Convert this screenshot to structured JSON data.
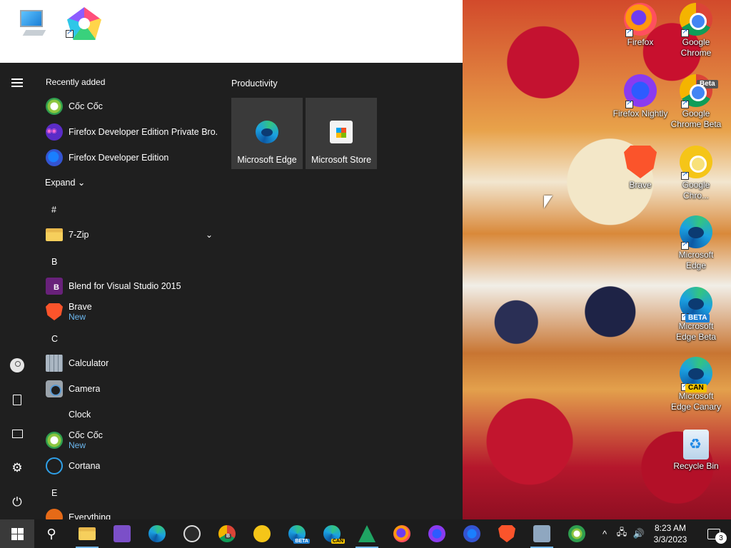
{
  "desktop": {
    "top_icons": [
      {
        "name": "this-pc",
        "icon": "computer-icon"
      },
      {
        "name": "coc-coc-shortcut",
        "icon": "coccoc-icon"
      }
    ],
    "right_icons": [
      {
        "label": "Firefox",
        "icon": "firefox-icon"
      },
      {
        "label": "Google Chrome",
        "icon": "chrome-icon"
      },
      {
        "label": "Firefox Nightly",
        "icon": "firefox-nightly-icon"
      },
      {
        "label": "Google Chrome Beta",
        "icon": "chrome-beta-icon",
        "badge": "Beta"
      },
      {
        "label": "Brave",
        "icon": "brave-icon"
      },
      {
        "label": "Google Chro...",
        "icon": "chrome-canary-icon"
      },
      {
        "label": "Microsoft Edge",
        "icon": "edge-icon"
      },
      {
        "label": "Microsoft Edge Beta",
        "icon": "edge-beta-icon",
        "badge": "BETA"
      },
      {
        "label": "Microsoft Edge Canary",
        "icon": "edge-canary-icon",
        "badge": "CAN"
      },
      {
        "label": "Recycle Bin",
        "icon": "recycle-bin-icon"
      }
    ]
  },
  "start_menu": {
    "recently_added_title": "Recently added",
    "recently_added": [
      {
        "name": "Cốc Cốc",
        "icon": "coccoc-icon"
      },
      {
        "name": "Firefox Developer Edition Private Bro...",
        "icon": "firefox-dev-private-icon"
      },
      {
        "name": "Firefox Developer Edition",
        "icon": "firefox-dev-icon"
      }
    ],
    "expand_label": "Expand",
    "letters": {
      "hash": "#",
      "b": "B",
      "c": "C",
      "e": "E"
    },
    "apps": [
      {
        "name": "7-Zip",
        "icon": "folder-icon"
      },
      {
        "name": "Blend for Visual Studio 2015",
        "icon": "blend-icon"
      },
      {
        "name": "Brave",
        "sub": "New",
        "icon": "brave-icon"
      },
      {
        "name": "Calculator",
        "icon": "calculator-icon"
      },
      {
        "name": "Camera",
        "icon": "camera-icon"
      },
      {
        "name": "Clock",
        "icon": "clock-icon"
      },
      {
        "name": "Cốc Cốc",
        "sub": "New",
        "icon": "coccoc-icon"
      },
      {
        "name": "Cortana",
        "icon": "cortana-icon"
      },
      {
        "name": "Everything",
        "icon": "everything-icon"
      }
    ],
    "tiles_title": "Productivity",
    "tiles": [
      {
        "label": "Microsoft Edge",
        "icon": "edge-icon"
      },
      {
        "label": "Microsoft Store",
        "icon": "store-icon"
      }
    ]
  },
  "taskbar": {
    "clock_time": "8:23 AM",
    "clock_date": "3/3/2023",
    "notification_count": "3",
    "pinned": [
      "start",
      "search",
      "file-explorer",
      "visual-studio",
      "edge",
      "obs",
      "chrome-beta",
      "chrome-canary",
      "edge-beta",
      "edge-canary",
      "google-sheets",
      "firefox",
      "firefox-nightly",
      "firefox-dev",
      "brave",
      "snipping-tool",
      "coccoc"
    ]
  },
  "colors": {
    "start_bg": "#1f1f1f",
    "taskbar_bg": "#1c1c1c",
    "accent": "#76b9ed",
    "new_label": "#6cb8f0"
  }
}
